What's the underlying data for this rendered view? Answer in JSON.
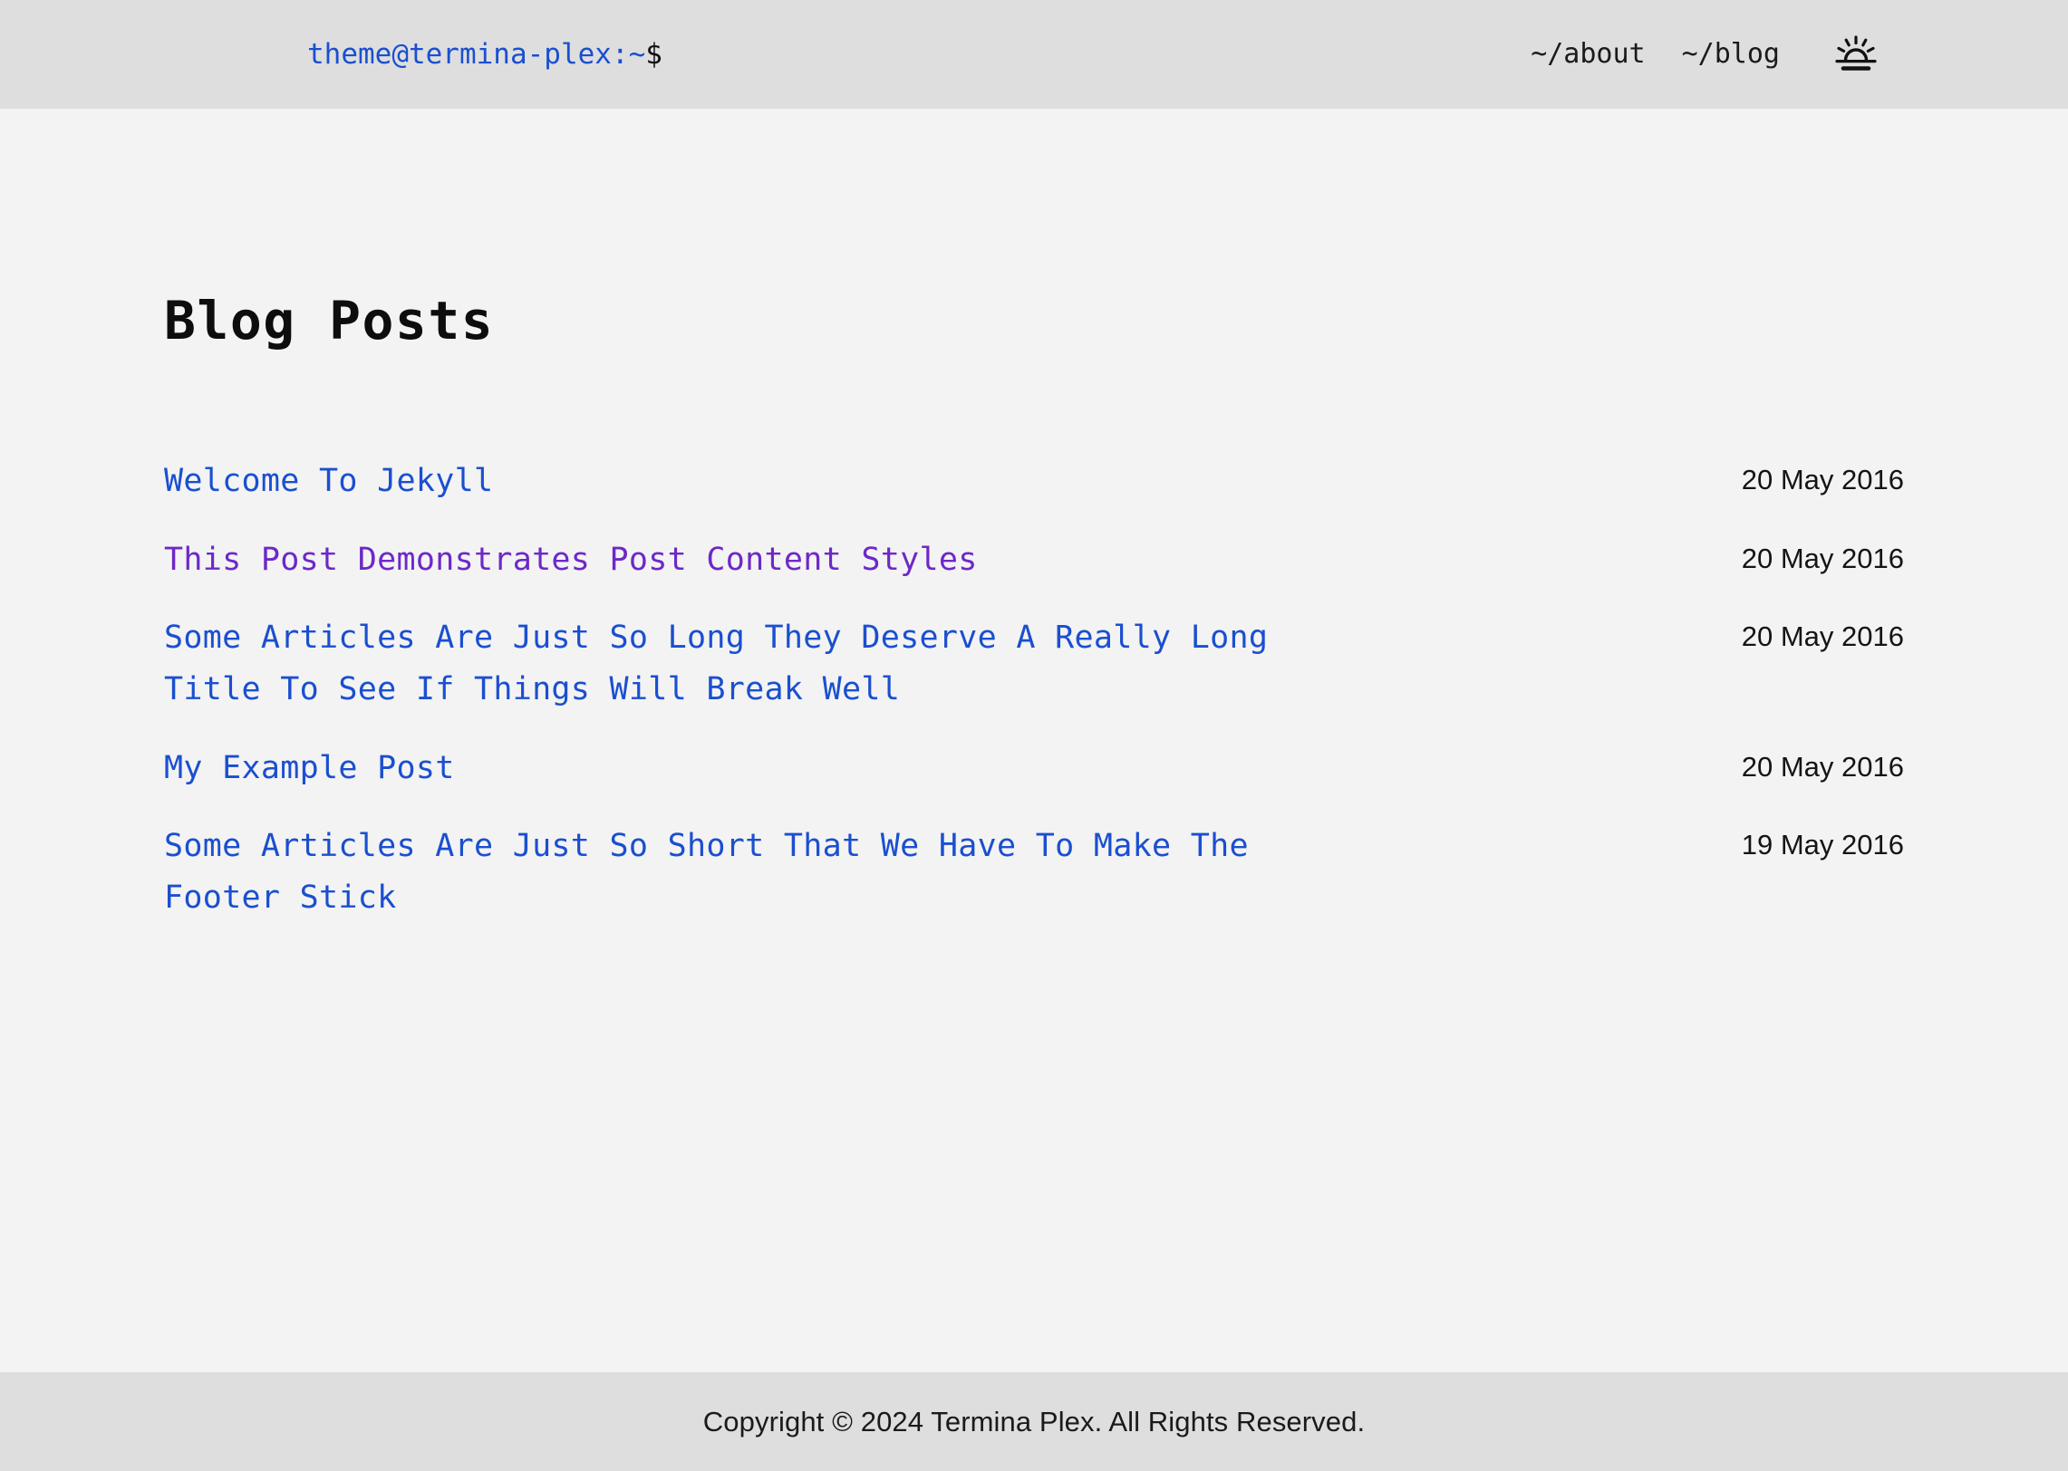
{
  "header": {
    "prompt_user": "theme@termina-plex:~",
    "prompt_sigil": "$",
    "nav": [
      {
        "label": "~/about"
      },
      {
        "label": "~/blog"
      }
    ],
    "theme_toggle_icon": "sunrise-icon"
  },
  "main": {
    "title": "Blog Posts",
    "posts": [
      {
        "title": "Welcome To Jekyll",
        "date": "20 May 2016",
        "visited": false
      },
      {
        "title": "This Post Demonstrates Post Content Styles",
        "date": "20 May 2016",
        "visited": true
      },
      {
        "title": "Some Articles Are Just So Long They Deserve A Really Long Title To See If Things Will Break Well",
        "date": "20 May 2016",
        "visited": false
      },
      {
        "title": "My Example Post",
        "date": "20 May 2016",
        "visited": false
      },
      {
        "title": "Some Articles Are Just So Short That We Have To Make The Footer Stick",
        "date": "19 May 2016",
        "visited": false
      }
    ]
  },
  "footer": {
    "copyright": "Copyright © 2024 Termina Plex. All Rights Reserved."
  },
  "colors": {
    "header_bg": "#dedede",
    "body_bg": "#f3f3f3",
    "link": "#1a4fd0",
    "link_visited": "#6d28c8",
    "text": "#1a1a1a"
  }
}
